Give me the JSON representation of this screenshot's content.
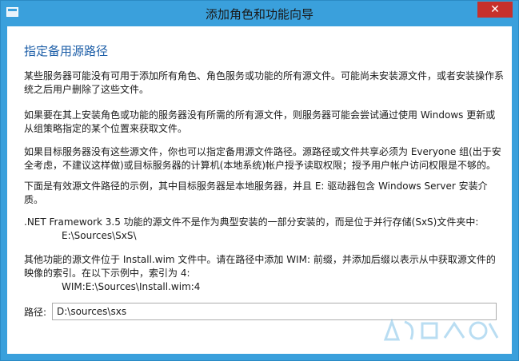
{
  "window": {
    "title": "添加角色和功能向导",
    "close_glyph": "✕"
  },
  "page": {
    "heading": "指定备用源路径",
    "paragraphs": {
      "p1": "某些服务器可能没有可用于添加所有角色、角色服务或功能的所有源文件。可能尚未安装源文件，或者安装操作系统之后用户删除了这些文件。",
      "p2": "如果要在其上安装角色或功能的服务器没有所需的所有源文件，则服务器可能会尝试通过使用 Windows 更新或从组策略指定的某个位置来获取文件。",
      "p3": "如果目标服务器没有这些源文件，你也可以指定备用源文件路径。源路径或文件共享必须为 Everyone 组(出于安全考虑，不建议这样做)或目标服务器的计算机(本地系统)帐户授予读取权限；授予用户帐户访问权限是不够的。",
      "p4": "下面是有效源文件路径的示例，其中目标服务器是本地服务器，并且 E: 驱动器包含 Windows Server 安装介质。",
      "p5": ".NET Framework 3.5 功能的源文件不是作为典型安装的一部分安装的，而是位于并行存储(SxS)文件夹中:",
      "p5_example": "E:\\Sources\\SxS\\",
      "p6": "其他功能的源文件位于 Install.wim 文件中。请在路径中添加 WIM: 前缀，并添加后缀以表示从中获取源文件的映像的索引。在以下示例中，索引为 4:",
      "p6_example": "WIM:E:\\Sources\\Install.wim:4"
    },
    "path_label": "路径:",
    "path_value": "D:\\sources\\sxs"
  },
  "colors": {
    "frame": "#3aa0dc",
    "close_button": "#c7302b",
    "heading": "#1e5fa8"
  }
}
